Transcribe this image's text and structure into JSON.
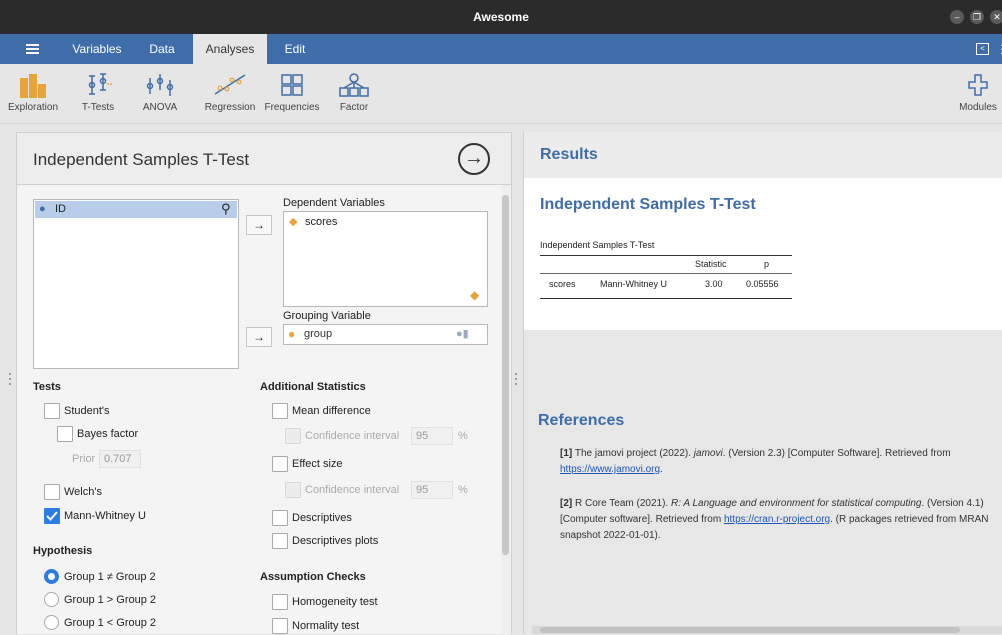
{
  "window": {
    "title": "Awesome",
    "controls": [
      "–",
      "❐",
      "✕"
    ]
  },
  "menubar": {
    "tabs": [
      {
        "label": "Variables",
        "active": false
      },
      {
        "label": "Data",
        "active": false
      },
      {
        "label": "Analyses",
        "active": true
      },
      {
        "label": "Edit",
        "active": false
      }
    ]
  },
  "ribbon": {
    "items": [
      {
        "label": "Exploration",
        "icon": "exploration-icon"
      },
      {
        "label": "T-Tests",
        "icon": "ttests-icon"
      },
      {
        "label": "ANOVA",
        "icon": "anova-icon"
      },
      {
        "label": "Regression",
        "icon": "regression-icon"
      },
      {
        "label": "Frequencies",
        "icon": "frequencies-icon"
      },
      {
        "label": "Factor",
        "icon": "factor-icon"
      }
    ],
    "modules_label": "Modules"
  },
  "analysis": {
    "title": "Independent Samples T-Test",
    "run_icon": "→",
    "available_variables": [
      "ID"
    ],
    "dependent_label": "Dependent Variables",
    "dependent_variables": [
      "scores"
    ],
    "grouping_label": "Grouping Variable",
    "grouping_variable": "group",
    "tests": {
      "heading": "Tests",
      "students": {
        "label": "Student's",
        "checked": false
      },
      "bayes": {
        "label": "Bayes factor",
        "checked": false
      },
      "prior_label": "Prior",
      "prior_value": "0.707",
      "welch": {
        "label": "Welch's",
        "checked": false
      },
      "mann_whitney": {
        "label": "Mann-Whitney U",
        "checked": true
      }
    },
    "hypothesis": {
      "heading": "Hypothesis",
      "options": [
        {
          "label": "Group 1 ≠ Group 2",
          "checked": true
        },
        {
          "label": "Group 1 > Group 2",
          "checked": false
        },
        {
          "label": "Group 1 < Group 2",
          "checked": false
        }
      ]
    },
    "additional": {
      "heading": "Additional Statistics",
      "mean_difference": "Mean difference",
      "ci_label": "Confidence interval",
      "ci_value": "95",
      "ci_unit": "%",
      "effect_size": "Effect size",
      "ci2_label": "Confidence interval",
      "ci2_value": "95",
      "ci2_unit": "%",
      "descriptives": "Descriptives",
      "descriptives_plots": "Descriptives plots"
    },
    "assumptions": {
      "heading": "Assumption Checks",
      "homogeneity": "Homogeneity test",
      "normality": "Normality test"
    }
  },
  "results": {
    "heading": "Results",
    "title": "Independent Samples T-Test",
    "table_caption": "Independent Samples T-Test",
    "columns": [
      "",
      "",
      "Statistic",
      "p"
    ],
    "rows": [
      {
        "var": "scores",
        "test": "Mann-Whitney U",
        "statistic": "3.00",
        "p": "0.05556"
      }
    ]
  },
  "references": {
    "heading": "References",
    "items": [
      {
        "num": "[1]",
        "pre": "The jamovi project (2022). ",
        "italic": "jamovi",
        "post": ". (Version 2.3) [Computer Software]. Retrieved from ",
        "link": "https://www.jamovi.org",
        "tail": "."
      },
      {
        "num": "[2]",
        "pre": "R Core Team (2021). ",
        "italic": "R: A Language and environment for statistical computing",
        "post": ". (Version 4.1) [Computer software]. Retrieved from ",
        "link": "https://cran.r-project.org",
        "tail": ". (R packages retrieved from MRAN snapshot 2022-01-01)."
      }
    ]
  }
}
